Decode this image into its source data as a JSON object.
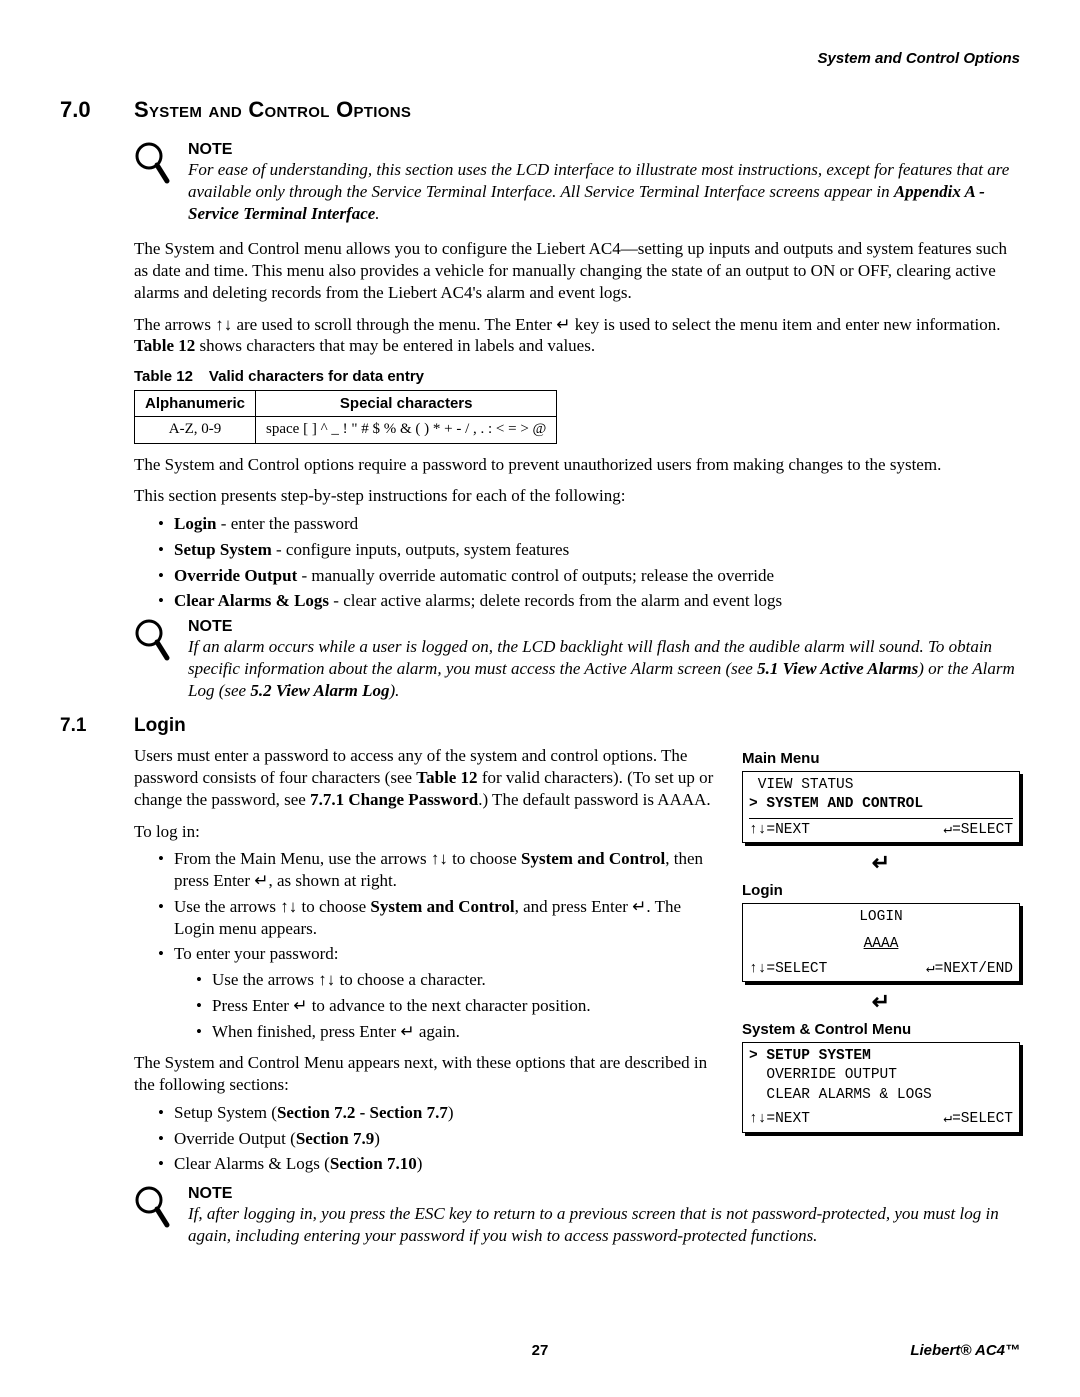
{
  "header": {
    "running": "System and Control Options"
  },
  "section": {
    "num": "7.0",
    "title": "System and Control Options"
  },
  "notes": {
    "label": "NOTE",
    "n1": "For ease of understanding, this section uses the LCD interface to illustrate most instructions, except for features that are available only through the Service Terminal Interface. All Service Terminal Interface screens appear in ",
    "n1b": "Appendix A - Service Terminal Interface",
    "n1c": ".",
    "n2": "If an alarm occurs while a user is logged on, the LCD backlight will flash and the audible alarm will sound. To obtain specific information about the alarm, you must access the Active Alarm screen (see ",
    "n2a": "5.1 View Active Alarms",
    "n2b": ") or the Alarm Log (see ",
    "n2c": "5.2 View Alarm Log",
    "n2d": ").",
    "n3": "If, after logging in, you press the ESC key to return to a previous screen that is not password-protected, you must log in again, including entering your password if you wish to access password-protected functions."
  },
  "paras": {
    "p1": "The System and Control menu allows you to configure the Liebert AC4—setting up inputs and outputs and system features such as date and time. This menu also provides a vehicle for manually changing the state of an output to ON or OFF, clearing active alarms and deleting records from the Liebert AC4's alarm and event logs.",
    "p2a": "The arrows ↑↓ are used to scroll through the menu. The Enter ↵ key is used to select the menu item and enter new information. ",
    "p2b": "Table 12",
    "p2c": " shows characters that may be entered in labels and values.",
    "p3": "The System and Control options require a password to prevent unauthorized users from making changes to the system.",
    "p4": "This section presents step-by-step instructions for each of the following:"
  },
  "bullets1": {
    "b1a": "Login",
    "b1b": " - enter the password",
    "b2a": "Setup System",
    "b2b": " - configure inputs, outputs, system features",
    "b3a": "Override Output",
    "b3b": " - manually override automatic control of outputs; release the override",
    "b4a": "Clear Alarms & Logs",
    "b4b": " - clear active alarms; delete records from the alarm and event logs"
  },
  "table": {
    "label": "Table 12",
    "caption": "Valid characters for data entry",
    "h1": "Alphanumeric",
    "h2": "Special characters",
    "c1": "A-Z, 0-9",
    "c2": "space [ ] ^ _ ! \" # $ % & ( ) * + - / , . : < = > @"
  },
  "sub": {
    "num": "7.1",
    "title": "Login"
  },
  "login": {
    "p1a": "Users must enter a password to access any of the system and control options. The password consists of four characters (see ",
    "p1b": "Table 12",
    "p1c": " for valid characters). (To set up or change the password, see ",
    "p1d": "7.7.1 Change Password",
    "p1e": ".) The default password is AAAA.",
    "p2": "To log in:",
    "b1a": "From the Main Menu, use the arrows ↑↓ to choose ",
    "b1b": "System and Control",
    "b1c": ", then press Enter ↵, as shown at right.",
    "b2a": "Use the arrows ↑↓ to choose ",
    "b2b": "System and Control",
    "b2c": ", and press Enter ↵. The Login menu appears.",
    "b3": "To enter your password:",
    "b3_1": "Use the arrows ↑↓ to choose a character.",
    "b3_2": "Press Enter ↵ to advance to the next character position.",
    "b3_3": "When finished, press Enter ↵ again.",
    "p3": "The System and Control Menu appears next, with these options that are described in the following sections:",
    "c1a": "Setup System (",
    "c1b": "Section 7.2 - Section 7.7",
    "c1c": ")",
    "c2a": "Override Output (",
    "c2b": "Section 7.9",
    "c2c": ")",
    "c3a": "Clear Alarms & Logs (",
    "c3b": "Section 7.10",
    "c3c": ")"
  },
  "lcd": {
    "mainTitle": "Main Menu",
    "m1": " VIEW STATUS",
    "m2": "> SYSTEM AND CONTROL",
    "mHintL": "↑↓=NEXT",
    "mHintR": "↵=SELECT",
    "loginTitle": "Login",
    "l1": "LOGIN",
    "l2": "AAAA",
    "lHintL": "↑↓=SELECT",
    "lHintR": "↵=NEXT/END",
    "scTitle": "System & Control Menu",
    "s1": "> SETUP SYSTEM",
    "s2": "  OVERRIDE OUTPUT",
    "s3": "  CLEAR ALARMS & LOGS",
    "sHintL": "↑↓=NEXT",
    "sHintR": "↵=SELECT",
    "enter": "↵"
  },
  "footer": {
    "page": "27",
    "product": "Liebert® AC4™"
  }
}
